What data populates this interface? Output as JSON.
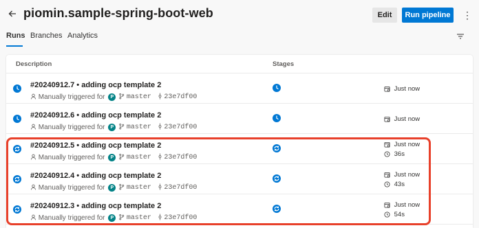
{
  "header": {
    "title": "piomin.sample-spring-boot-web",
    "edit_label": "Edit",
    "run_label": "Run pipeline",
    "more_glyph": "⋮"
  },
  "tabs": [
    {
      "label": "Runs",
      "active": true
    },
    {
      "label": "Branches",
      "active": false
    },
    {
      "label": "Analytics",
      "active": false
    }
  ],
  "table": {
    "col_description": "Description",
    "col_stages": "Stages"
  },
  "runs": [
    {
      "title": "#20240912.7 • adding ocp template 2",
      "trigger": "Manually triggered for",
      "avatar": "P",
      "branch": "master",
      "commit": "23e7df00",
      "status": "queued",
      "when": "Just now",
      "duration": ""
    },
    {
      "title": "#20240912.6 • adding ocp template 2",
      "trigger": "Manually triggered for",
      "avatar": "P",
      "branch": "master",
      "commit": "23e7df00",
      "status": "queued",
      "when": "Just now",
      "duration": ""
    },
    {
      "title": "#20240912.5 • adding ocp template 2",
      "trigger": "Manually triggered for",
      "avatar": "P",
      "branch": "master",
      "commit": "23e7df00",
      "status": "running",
      "when": "Just now",
      "duration": "36s"
    },
    {
      "title": "#20240912.4 • adding ocp template 2",
      "trigger": "Manually triggered for",
      "avatar": "P",
      "branch": "master",
      "commit": "23e7df00",
      "status": "running",
      "when": "Just now",
      "duration": "43s"
    },
    {
      "title": "#20240912.3 • adding ocp template 2",
      "trigger": "Manually triggered for",
      "avatar": "P",
      "branch": "master",
      "commit": "23e7df00",
      "status": "running",
      "when": "Just now",
      "duration": "54s"
    }
  ],
  "colors": {
    "accent": "#0078d4",
    "highlight": "#e8402a",
    "avatar": "#038387"
  }
}
